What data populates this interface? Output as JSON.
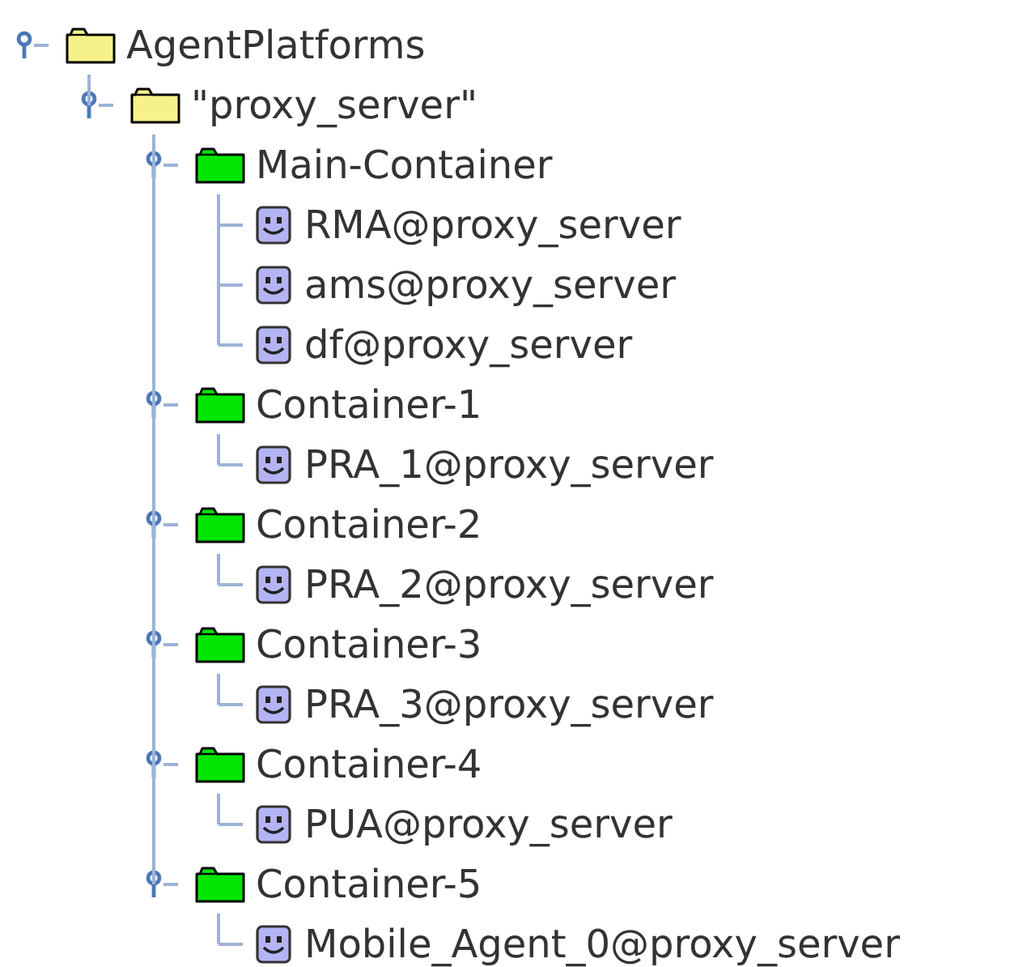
{
  "tree": [
    {
      "kind": "platform",
      "label": "AgentPlatforms",
      "expanded": true,
      "children": [
        {
          "kind": "platform",
          "label": "\"proxy_server\"",
          "expanded": true,
          "children": [
            {
              "kind": "container",
              "label": "Main-Container",
              "expanded": true,
              "children": [
                {
                  "kind": "agent",
                  "label": "RMA@proxy_server"
                },
                {
                  "kind": "agent",
                  "label": "ams@proxy_server"
                },
                {
                  "kind": "agent",
                  "label": "df@proxy_server"
                }
              ]
            },
            {
              "kind": "container",
              "label": "Container-1",
              "expanded": true,
              "children": [
                {
                  "kind": "agent",
                  "label": "PRA_1@proxy_server"
                }
              ]
            },
            {
              "kind": "container",
              "label": "Container-2",
              "expanded": true,
              "children": [
                {
                  "kind": "agent",
                  "label": "PRA_2@proxy_server"
                }
              ]
            },
            {
              "kind": "container",
              "label": "Container-3",
              "expanded": true,
              "children": [
                {
                  "kind": "agent",
                  "label": "PRA_3@proxy_server"
                }
              ]
            },
            {
              "kind": "container",
              "label": "Container-4",
              "expanded": true,
              "children": [
                {
                  "kind": "agent",
                  "label": "PUA@proxy_server"
                }
              ]
            },
            {
              "kind": "container",
              "label": "Container-5",
              "expanded": true,
              "children": [
                {
                  "kind": "agent",
                  "label": "Mobile_Agent_0@proxy_server"
                }
              ]
            }
          ]
        }
      ]
    }
  ]
}
